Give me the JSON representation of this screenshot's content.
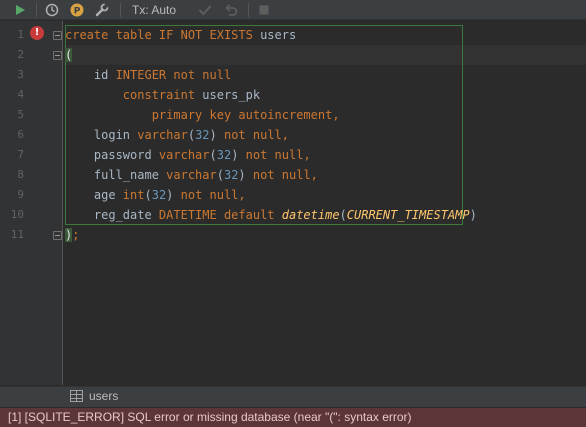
{
  "toolbar": {
    "tx_mode": "Tx: Auto",
    "icons": [
      "run-icon",
      "history-icon",
      "profile-icon",
      "settings-icon",
      "commit-icon",
      "rollback-icon",
      "stop-icon"
    ]
  },
  "editor": {
    "line_numbers": [
      "1",
      "2",
      "3",
      "4",
      "5",
      "6",
      "7",
      "8",
      "9",
      "10",
      "11"
    ],
    "lines": [
      [
        "create table ",
        "IF NOT EXISTS ",
        "users"
      ],
      [
        "("
      ],
      [
        "    id ",
        "INTEGER not null"
      ],
      [
        "        constraint ",
        "users_pk"
      ],
      [
        "            primary key autoincrement",
        ","
      ],
      [
        "    login ",
        "varchar",
        "(",
        "32",
        ") ",
        "not null",
        ","
      ],
      [
        "    password ",
        "varchar",
        "(",
        "32",
        ") ",
        "not null",
        ","
      ],
      [
        "    full_name ",
        "varchar",
        "(",
        "32",
        ") ",
        "not null",
        ","
      ],
      [
        "    age ",
        "int",
        "(",
        "32",
        ") ",
        "not null",
        ","
      ],
      [
        "    reg_date ",
        "DATETIME default ",
        "datetime",
        "(",
        "CURRENT_TIMESTAMP",
        ")"
      ],
      [
        ")",
        ";"
      ]
    ]
  },
  "console": {
    "tab_label": "users"
  },
  "status": {
    "error_message": "[1] [SQLITE_ERROR] SQL error or missing database (near \"(\": syntax error)"
  },
  "colors": {
    "background": "#2b2b2b",
    "keyword": "#cc7832",
    "number": "#6897bb",
    "function": "#ffc66d",
    "error_bar": "#5c3636"
  }
}
